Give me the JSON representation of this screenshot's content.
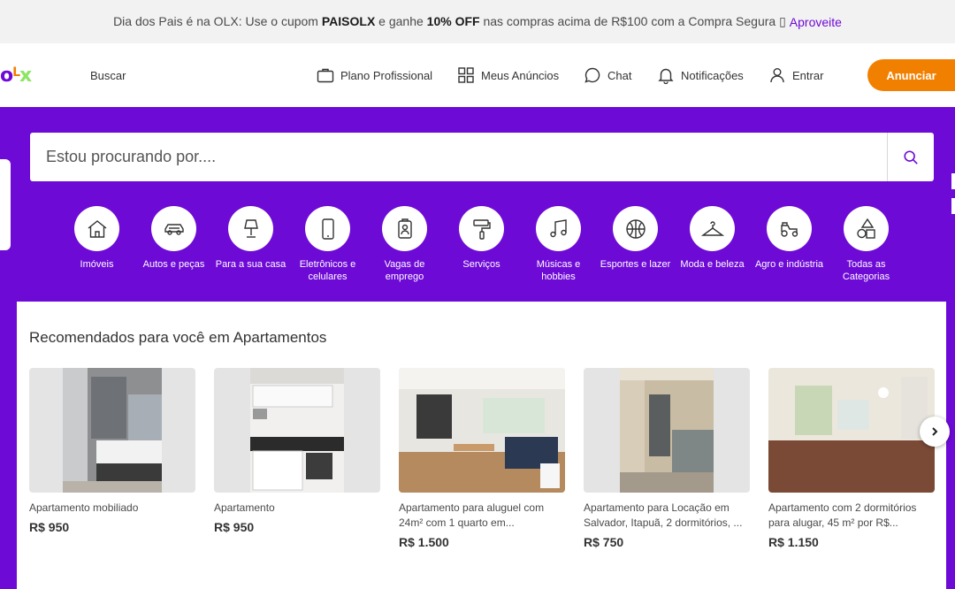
{
  "promo": {
    "t1": "Dia dos Pais é na OLX: Use o cupom ",
    "b1": "PAISOLX",
    "t2": " e ganhe ",
    "b2": "10% OFF",
    "t3": " nas compras acima de R$100 com a Compra Segura ▯",
    "link": "Aproveite"
  },
  "header": {
    "logo_o": "o",
    "logo_l": "L",
    "logo_x": "x",
    "buscar": "Buscar",
    "nav": {
      "plano": "Plano Profissional",
      "anuncios": "Meus Anúncios",
      "chat": "Chat",
      "notificacoes": "Notificações",
      "entrar": "Entrar"
    },
    "anunciar": "Anunciar"
  },
  "search": {
    "placeholder": "Estou procurando por...."
  },
  "categories": [
    {
      "label": "Imóveis",
      "icon": "house-icon"
    },
    {
      "label": "Autos e peças",
      "icon": "car-icon"
    },
    {
      "label": "Para a sua casa",
      "icon": "lamp-icon"
    },
    {
      "label": "Eletrônicos e celulares",
      "icon": "phone-icon"
    },
    {
      "label": "Vagas de emprego",
      "icon": "badge-icon"
    },
    {
      "label": "Serviços",
      "icon": "paint-roller-icon"
    },
    {
      "label": "Músicas e hobbies",
      "icon": "music-icon"
    },
    {
      "label": "Esportes e lazer",
      "icon": "ball-icon"
    },
    {
      "label": "Moda e beleza",
      "icon": "hanger-icon"
    },
    {
      "label": "Agro e indústria",
      "icon": "tractor-icon"
    },
    {
      "label": "Todas as Categorias",
      "icon": "shapes-icon"
    }
  ],
  "recommended": {
    "title": "Recomendados para você em Apartamentos",
    "items": [
      {
        "title": "Apartamento mobiliado",
        "price": "R$ 950"
      },
      {
        "title": "Apartamento",
        "price": "R$ 950"
      },
      {
        "title": "Apartamento para aluguel com 24m² com 1 quarto em...",
        "price": "R$ 1.500"
      },
      {
        "title": "Apartamento para Locação em Salvador, Itapuã, 2 dormitórios, ...",
        "price": "R$ 750"
      },
      {
        "title": "Apartamento com 2 dormitórios para alugar, 45 m² por R$...",
        "price": "R$ 1.150"
      }
    ]
  },
  "colors": {
    "brand_purple": "#6e0ad6",
    "brand_orange": "#f28000",
    "brand_green": "#8ce563"
  }
}
